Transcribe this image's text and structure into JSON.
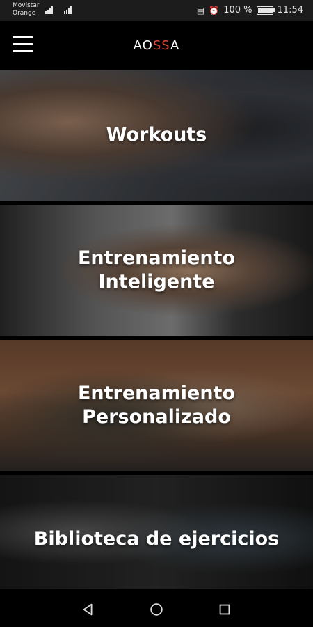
{
  "status_bar": {
    "carrier_line1": "Movistar",
    "carrier_line2": "Orange",
    "battery_text": "100 %",
    "time": "11:54",
    "icons": [
      "signal-icon",
      "nfc-icon",
      "alarm-icon",
      "battery-icon"
    ]
  },
  "app_bar": {
    "logo": {
      "part1": "AO",
      "part2": "SS",
      "part3": "A"
    },
    "menu_icon": "hamburger-menu-icon"
  },
  "tiles": [
    {
      "label": "Workouts"
    },
    {
      "label": "Entrenamiento Inteligente"
    },
    {
      "label": "Entrenamiento Personalizado"
    },
    {
      "label": "Biblioteca de ejercicios"
    }
  ],
  "nav_bar": {
    "icons": [
      "back-icon",
      "home-icon",
      "recents-icon"
    ]
  },
  "colors": {
    "accent": "#e84b3a",
    "background": "#000000",
    "separator": "#f2f2f2"
  },
  "battery_level": 1.0
}
